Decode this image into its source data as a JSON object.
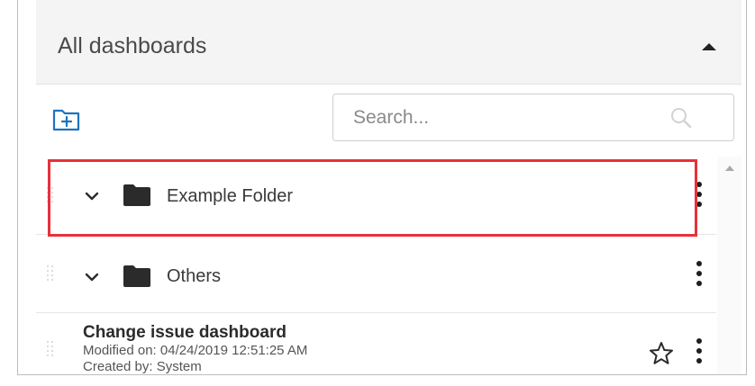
{
  "panel": {
    "title": "All dashboards"
  },
  "toolbar": {
    "new_folder_icon": "folder-plus-icon",
    "search": {
      "placeholder": "Search...",
      "value": ""
    }
  },
  "folders": [
    {
      "label": "Example Folder",
      "highlighted": true
    },
    {
      "label": "Others",
      "highlighted": false
    }
  ],
  "dashboards": [
    {
      "title": "Change issue dashboard",
      "modified": "Modified on: 04/24/2019 12:51:25 AM",
      "created": "Created by: System"
    }
  ],
  "colors": {
    "accent_blue": "#1e73be",
    "highlight_red": "#e8303b",
    "header_bg": "#f4f4f4",
    "folder_icon": "#2b2b2b"
  }
}
